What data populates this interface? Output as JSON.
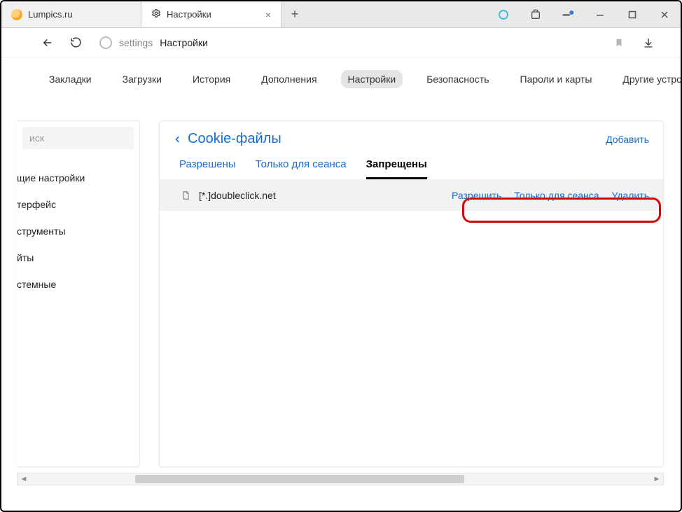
{
  "tabs": {
    "inactive": {
      "title": "Lumpics.ru"
    },
    "active": {
      "title": "Настройки"
    }
  },
  "address": {
    "secondary": "settings",
    "primary": "Настройки"
  },
  "menubar": {
    "items": [
      "Закладки",
      "Загрузки",
      "История",
      "Дополнения",
      "Настройки",
      "Безопасность",
      "Пароли и карты",
      "Другие устройства"
    ],
    "active_index": 4
  },
  "sidebar": {
    "search_placeholder": "иск",
    "items": [
      "щие настройки",
      "терфейс",
      "струменты",
      "йты",
      "стемные"
    ]
  },
  "main": {
    "title": "Cookie-файлы",
    "add_label": "Добавить",
    "subtabs": {
      "items": [
        "Разрешены",
        "Только для сеанса",
        "Запрещены"
      ],
      "active_index": 2
    },
    "row": {
      "domain": "[*.]doubleclick.net",
      "actions": {
        "allow": "Разрешить",
        "session": "Только для сеанса",
        "delete": "Удалить"
      }
    }
  }
}
